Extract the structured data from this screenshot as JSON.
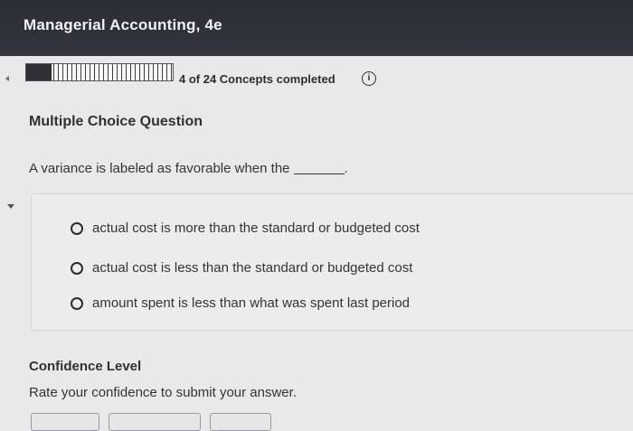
{
  "header": {
    "app_title": "Managerial Accounting, 4e"
  },
  "progress": {
    "completed": 4,
    "total": 24,
    "fraction": 0.17,
    "text": "4 of 24 Concepts completed",
    "info_icon": "info-icon"
  },
  "question": {
    "type_label": "Multiple Choice Question",
    "prompt": "A variance is labeled as favorable when the",
    "options": [
      {
        "label": "actual cost is more than the standard or budgeted cost",
        "selected": false
      },
      {
        "label": "actual cost is less than the standard or budgeted cost",
        "selected": false
      },
      {
        "label": "amount spent is less than what was spent last period",
        "selected": false
      }
    ]
  },
  "confidence": {
    "title": "Confidence Level",
    "subtitle": "Rate your confidence to submit your answer."
  }
}
